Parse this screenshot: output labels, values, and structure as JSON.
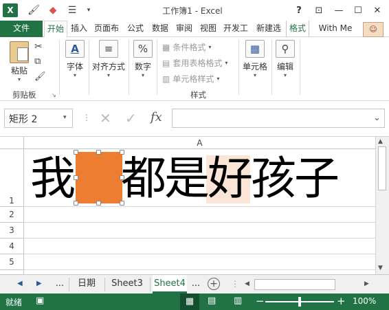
{
  "window": {
    "title": "工作簿1 - Excel"
  },
  "qat": {
    "undo_icon": "undo-icon",
    "redo_icon": "redo-icon"
  },
  "window_controls": {
    "help": "?",
    "ribbon_display": "⊡",
    "minimize": "—",
    "restore": "☐",
    "close": "✕"
  },
  "tabs": {
    "file": "文件",
    "home": "开始",
    "insert": "插入",
    "page_layout": "页面布",
    "formulas": "公式",
    "data": "数据",
    "review": "审阅",
    "view": "视图",
    "developer": "开发工",
    "new_tab": "新建选",
    "format": "格式",
    "tell_me": "With Me"
  },
  "ribbon": {
    "paste": "粘贴",
    "clipboard_group": "剪贴板",
    "font": "字体",
    "align": "对齐方式",
    "number": "数字",
    "conditional_format": "条件格式",
    "table_format": "套用表格格式",
    "cell_styles": "单元格样式",
    "styles_group": "样式",
    "cells": "单元格",
    "editing": "编辑"
  },
  "formula_bar": {
    "name_box": "矩形 2",
    "fx": "fx",
    "formula": ""
  },
  "grid": {
    "column_a": "A",
    "rows": [
      "1",
      "2",
      "3",
      "4",
      "5"
    ],
    "cell_text_left": "我",
    "cell_text_right": "都是好孩子"
  },
  "sheets": {
    "ellipsis_left": "...",
    "tab1": "日期",
    "tab2": "Sheet3",
    "tab3": "Sheet4",
    "ellipsis_right": "..."
  },
  "status": {
    "ready": "就绪",
    "zoom_out": "−",
    "zoom_in": "+",
    "zoom": "100%",
    "zoom_level": 0.5
  },
  "colors": {
    "excel_green": "#217346",
    "shape_orange": "#ed7d31",
    "highlight": "#fbe5d6"
  }
}
